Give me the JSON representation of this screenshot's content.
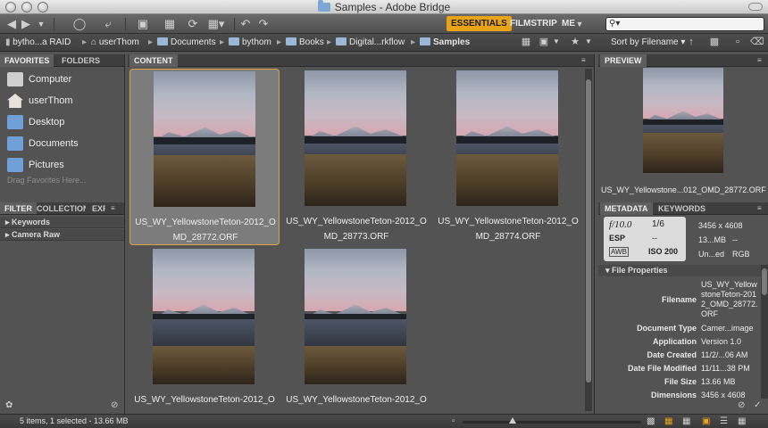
{
  "window": {
    "title": "Samples - Adobe Bridge"
  },
  "toolbar": {
    "back_icon": "back-arrow-icon",
    "forward_icon": "forward-arrow-icon",
    "workspaces": [
      "ESSENTIALS",
      "FILMSTRIP",
      "ME"
    ],
    "active_workspace": "ESSENTIALS",
    "search_placeholder": "",
    "accent_color": "#e8a317"
  },
  "path": {
    "crumbs": [
      "bytho...a RAID",
      "userThom",
      "Documents",
      "bythom",
      "Books",
      "Digital...rkflow",
      "Samples"
    ],
    "sort_label": "Sort by Filename"
  },
  "left": {
    "tabs": [
      "FAVORITES",
      "FOLDERS"
    ],
    "favorites": [
      {
        "label": "Computer"
      },
      {
        "label": "userThom"
      },
      {
        "label": "Desktop"
      },
      {
        "label": "Documents"
      },
      {
        "label": "Pictures"
      }
    ],
    "drag_hint": "Drag Favorites Here...",
    "filter_tabs": [
      "FILTER",
      "COLLECTIONS",
      "EXPORT"
    ],
    "filter_rows": [
      "Keywords",
      "Camera Raw"
    ]
  },
  "content": {
    "tab": "CONTENT",
    "items": [
      {
        "line1": "US_WY_YellowstoneTeton-2012_O",
        "line2": "MD_28772.ORF",
        "selected": true
      },
      {
        "line1": "US_WY_YellowstoneTeton-2012_O",
        "line2": "MD_28773.ORF",
        "selected": false
      },
      {
        "line1": "US_WY_YellowstoneTeton-2012_O",
        "line2": "MD_28774.ORF",
        "selected": false
      },
      {
        "line1": "US_WY_YellowstoneTeton-2012_O",
        "line2": "",
        "selected": false
      },
      {
        "line1": "US_WY_YellowstoneTeton-2012_O",
        "line2": "",
        "selected": false
      }
    ]
  },
  "preview": {
    "tab": "PREVIEW",
    "caption": "US_WY_Yellowstone...012_OMD_28772.ORF"
  },
  "metadata": {
    "tabs": [
      "METADATA",
      "KEYWORDS"
    ],
    "aperture": "f/10.0",
    "shutter": "1/6",
    "exposure_mode": "ESP",
    "exposure_comp": "--",
    "white_balance": "AWB",
    "iso": "ISO 200",
    "dimensions_short": "3456 x 4608",
    "size_short": "13...MB",
    "size_dash": "--",
    "color_profile": "Un...ed",
    "color_mode": "RGB",
    "file_properties_header": "File Properties",
    "file_properties": [
      {
        "key": "Filename",
        "value": "US_WY_YellowstoneTeton-2012_OMD_28772.ORF"
      },
      {
        "key": "Document Type",
        "value": "Camer...image"
      },
      {
        "key": "Application",
        "value": "Version 1.0"
      },
      {
        "key": "Date Created",
        "value": "11/2/...06 AM"
      },
      {
        "key": "Date File Modified",
        "value": "11/11...38 PM"
      },
      {
        "key": "File Size",
        "value": "13.66 MB"
      },
      {
        "key": "Dimensions",
        "value": "3456 x 4608"
      }
    ]
  },
  "status": {
    "text": "5 items, 1 selected - 13.66 MB",
    "thumb_size_level": 0.28
  }
}
